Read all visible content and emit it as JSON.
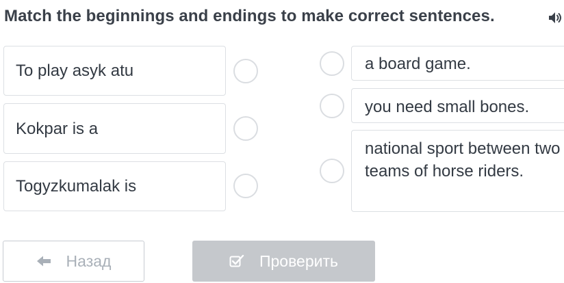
{
  "task": {
    "title": "Match the beginnings and endings to make correct sentences."
  },
  "beginnings": [
    {
      "text": "To play asyk atu"
    },
    {
      "text": "Kokpar is a"
    },
    {
      "text": "Togyzkumalak is"
    }
  ],
  "endings": [
    {
      "text": "a board game."
    },
    {
      "text": "you need small bones."
    },
    {
      "text": "national sport between two teams of horse riders."
    }
  ],
  "buttons": {
    "back_label": "Назад",
    "check_label": "Проверить"
  },
  "icons": {
    "audio": "speaker-icon",
    "back": "arrow-left-icon",
    "check": "checkbox-icon"
  },
  "colors": {
    "text": "#333a43",
    "card_border": "#dcdfe3",
    "disabled_button": "#c5c8cc",
    "back_button_text": "#a9b0b8"
  }
}
